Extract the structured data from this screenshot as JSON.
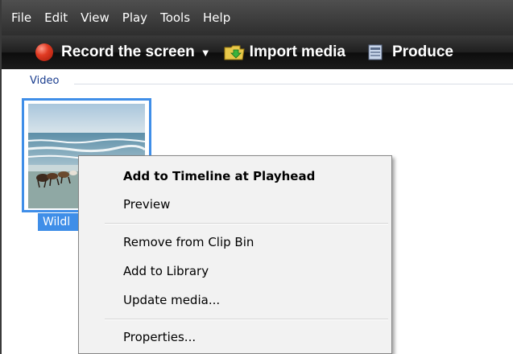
{
  "menubar": {
    "items": [
      "File",
      "Edit",
      "View",
      "Play",
      "Tools",
      "Help"
    ]
  },
  "toolbar": {
    "record_label": "Record the screen",
    "import_label": "Import media",
    "produce_label": "Produce"
  },
  "clip_bin": {
    "section_label": "Video",
    "clip_name": "Wildl"
  },
  "context_menu": {
    "items": [
      "Add to Timeline at Playhead",
      "Preview",
      "Remove from Clip Bin",
      "Add to Library",
      "Update media...",
      "Properties..."
    ]
  },
  "colors": {
    "selection": "#3f8ee8",
    "record": "#e03a22",
    "section_text": "#1a3d8f"
  }
}
